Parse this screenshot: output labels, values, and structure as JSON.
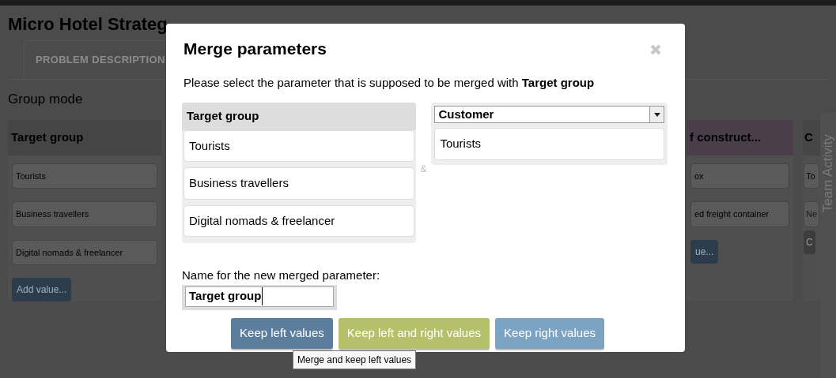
{
  "page": {
    "title": "Micro Hotel Strateg",
    "tab": "PROBLEM DESCRIPTION",
    "mode": "Group mode"
  },
  "columns": [
    {
      "title": "Target group",
      "color": "#454545",
      "values": [
        "Tourists",
        "Business travellers",
        "Digital nomads & freelancer"
      ],
      "button": "Add value..."
    },
    {
      "title": "f construct...",
      "color": "#4a3e4a",
      "values": [
        "ox",
        "ed freight container"
      ],
      "button": "ue..."
    },
    {
      "title": "C",
      "color": "#464646",
      "values": [
        "To"
      ],
      "input_placeholder": "Ne",
      "button": "C"
    }
  ],
  "side_panel": {
    "title": "Team Activity"
  },
  "dialog": {
    "title": "Merge parameters",
    "instruction": "Please select the parameter that is supposed to be merged with **Target group**",
    "left": {
      "header": "Target group",
      "values": [
        "Tourists",
        "Business travellers",
        "Digital nomads & freelancer"
      ]
    },
    "separator": "&",
    "right": {
      "select": "Customer",
      "values": [
        "Tourists"
      ]
    },
    "name_label": "Name for the new merged parameter:",
    "name_value": "Target group",
    "buttons": [
      {
        "label": "Keep left values",
        "kind": "left"
      },
      {
        "label": "Keep left and right values",
        "kind": "both"
      },
      {
        "label": "Keep right values",
        "kind": "right"
      }
    ],
    "tooltip": "Merge and keep left values"
  }
}
